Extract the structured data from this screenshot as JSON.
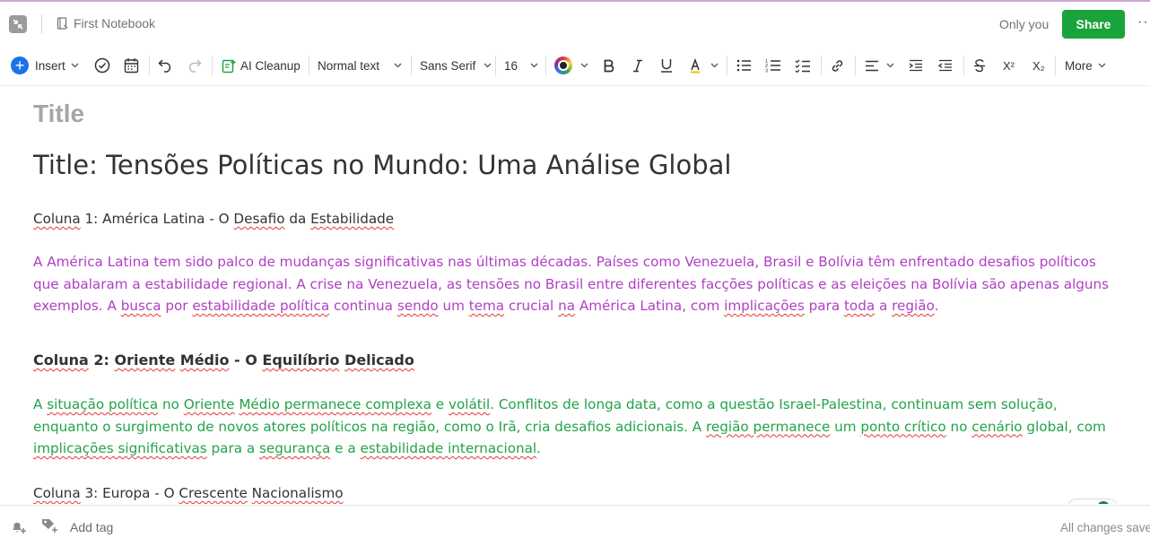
{
  "header": {
    "notebook_name": "First Notebook",
    "sharing_status": "Only you",
    "share_label": "Share",
    "more_dots": "···"
  },
  "toolbar": {
    "insert_label": "Insert",
    "ai_cleanup_label": "AI Cleanup",
    "text_style": "Normal text",
    "font_family": "Sans Serif",
    "font_size": "16",
    "superscript": "X²",
    "subscript": "X₂",
    "more_label": "More"
  },
  "note": {
    "title_placeholder": "Title",
    "doc_title": "Title: Tensões Políticas no Mundo: Uma Análise Global",
    "sections": [
      {
        "heading_parts": [
          "Coluna",
          " 1: América Latina - O ",
          "Desafio",
          " da ",
          "Estabilidade"
        ],
        "body_parts": [
          "A América Latina tem sido palco de mudanças significativas nas últimas décadas. Países como Venezuela, Brasil e Bolívia têm enfrentado desafios políticos que abalaram a estabilidade regional. A crise na Venezuela, as tensões no Brasil entre diferentes facções políticas e as eleições na Bolívia são apenas alguns exemplos. A ",
          "busca",
          " por ",
          "estabilidade política",
          " continua ",
          "sendo",
          " um ",
          "tema",
          " crucial ",
          "na",
          " América Latina, com ",
          "implicações",
          " para ",
          "toda",
          " a ",
          "região",
          "."
        ]
      },
      {
        "heading_parts": [
          "Coluna",
          " 2: ",
          "Oriente",
          " ",
          "Médio",
          " - O ",
          "Equilíbrio",
          " ",
          "Delicado"
        ],
        "body_parts": [
          "A ",
          "situação política",
          " no ",
          "Oriente",
          " ",
          "Médio permanece complexa",
          " e ",
          "volátil",
          ". Conflitos de longa data, como a questão Israel-Palestina, continuam sem solução, enquanto o surgimento de novos atores políticos na região, como o Irã, cria desafios adicionais. A ",
          "região permanece",
          " um ",
          "ponto crítico",
          " no ",
          "cenário",
          " global, com ",
          "implicações significativas",
          " para a ",
          "segurança",
          " e a ",
          "estabilidade internacional",
          "."
        ]
      },
      {
        "heading_parts": [
          "Coluna",
          " 3: Europa - O ",
          "Crescente",
          " ",
          "Nacionalismo"
        ]
      }
    ]
  },
  "footer": {
    "add_tag_label": "Add tag",
    "save_status": "All changes saved"
  },
  "colors": {
    "share_green": "#1aa33b",
    "insert_blue": "#1a73e8",
    "section1_text": "#b03fc4",
    "section2_text": "#23a347",
    "spellcheck_red": "#e53935"
  }
}
